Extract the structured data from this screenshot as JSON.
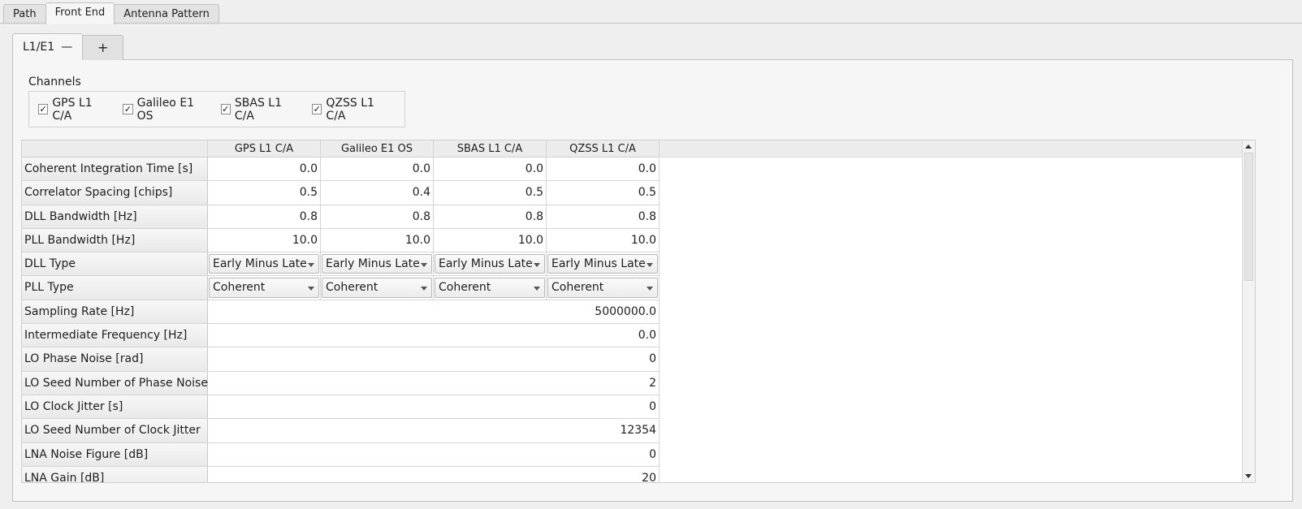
{
  "top_tabs": [
    "Path",
    "Front End",
    "Antenna Pattern"
  ],
  "active_top_tab": "Front End",
  "inner_tabs": {
    "active_label": "L1/E1",
    "remove_glyph": "—",
    "add_glyph": "+"
  },
  "channels": {
    "title": "Channels",
    "items": [
      {
        "label": "GPS L1 C/A",
        "checked": true
      },
      {
        "label": "Galileo E1 OS",
        "checked": true
      },
      {
        "label": "SBAS L1 C/A",
        "checked": true
      },
      {
        "label": "QZSS L1 C/A",
        "checked": true
      }
    ],
    "check_glyph": "✓"
  },
  "table": {
    "columns": [
      "GPS L1 C/A",
      "Galileo E1 OS",
      "SBAS L1 C/A",
      "QZSS L1 C/A"
    ],
    "per_channel_rows": [
      {
        "label": "Coherent Integration Time [s]",
        "values": [
          "0.0",
          "0.0",
          "0.0",
          "0.0"
        ]
      },
      {
        "label": "Correlator Spacing [chips]",
        "values": [
          "0.5",
          "0.4",
          "0.5",
          "0.5"
        ]
      },
      {
        "label": "DLL Bandwidth [Hz]",
        "values": [
          "0.8",
          "0.8",
          "0.8",
          "0.8"
        ]
      },
      {
        "label": "PLL Bandwidth [Hz]",
        "values": [
          "10.0",
          "10.0",
          "10.0",
          "10.0"
        ]
      }
    ],
    "combo_rows": [
      {
        "label": "DLL Type",
        "values": [
          "Early Minus Late",
          "Early Minus Late",
          "Early Minus Late",
          "Early Minus Late"
        ]
      },
      {
        "label": "PLL Type",
        "values": [
          "Coherent",
          "Coherent",
          "Coherent",
          "Coherent"
        ]
      }
    ],
    "shared_rows": [
      {
        "label": "Sampling Rate [Hz]",
        "value": "5000000.0"
      },
      {
        "label": "Intermediate Frequency [Hz]",
        "value": "0.0"
      },
      {
        "label": "LO Phase Noise [rad]",
        "value": "0"
      },
      {
        "label": "LO Seed Number of Phase Noise",
        "value": "2"
      },
      {
        "label": "LO Clock Jitter [s]",
        "value": "0"
      },
      {
        "label": "LO Seed Number of Clock Jitter",
        "value": "12354"
      },
      {
        "label": "LNA Noise Figure [dB]",
        "value": "0"
      },
      {
        "label": "LNA Gain [dB]",
        "value": "20"
      }
    ]
  }
}
